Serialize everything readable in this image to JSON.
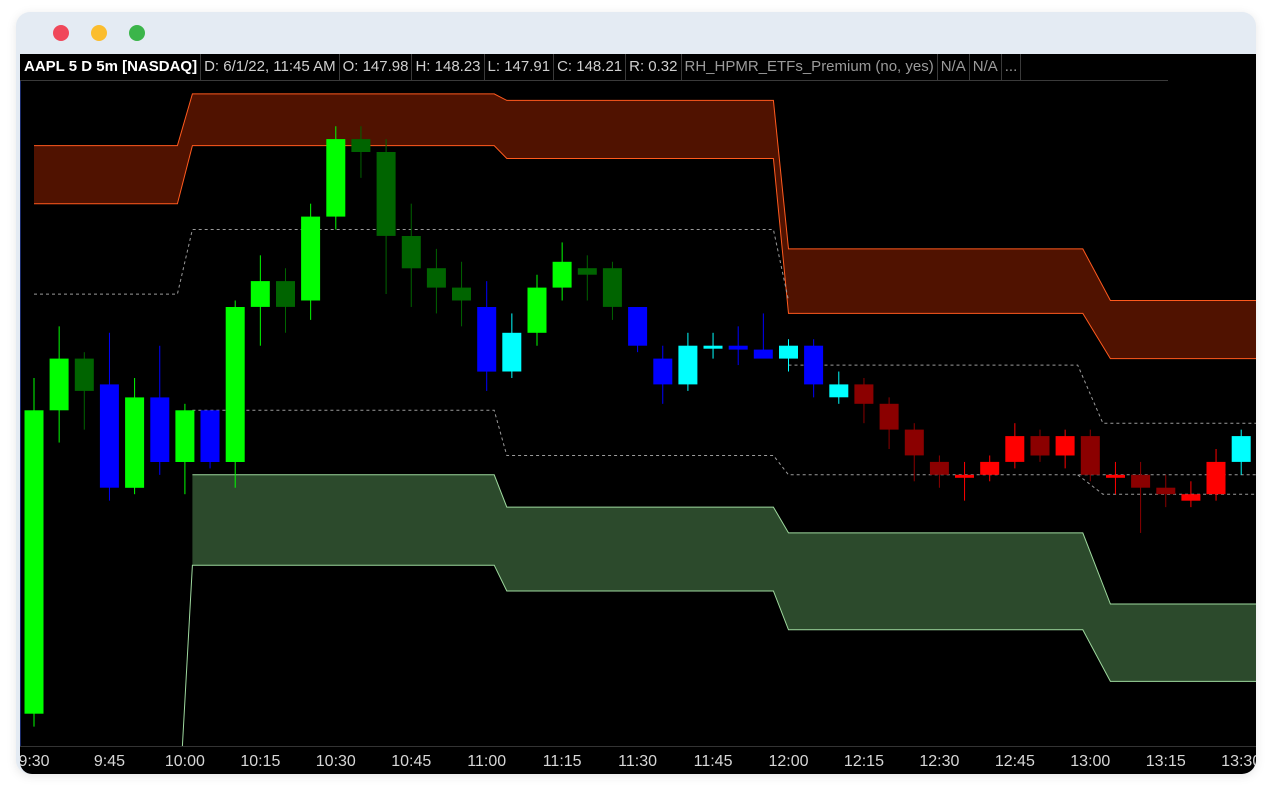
{
  "window": {
    "controls": [
      "close",
      "minimize",
      "zoom"
    ]
  },
  "header": {
    "symbol": "AAPL 5 D 5m [NASDAQ]",
    "date": "D: 6/1/22, 11:45 AM",
    "open": "O: 147.98",
    "high": "H: 148.23",
    "low": "L: 147.91",
    "close": "C: 148.21",
    "range": "R: 0.32",
    "study": "RH_HPMR_ETFs_Premium (no, yes)",
    "na1": "N/A",
    "na2": "N/A",
    "more": "..."
  },
  "colors": {
    "background": "#000000",
    "up_strong": "#00ff00",
    "up_weak": "#006400",
    "down_strong": "#ff0000",
    "down_weak": "#8b0000",
    "cyan": "#00ffff",
    "blue": "#0000ff",
    "upper_band_fill": "#501200",
    "upper_band_line": "#ff5a1e",
    "lower_band_fill": "#2c4a2c",
    "lower_band_line": "#9ed99e",
    "dashed": "#9a9a9a"
  },
  "chart_data": {
    "type": "candlestick",
    "symbol": "AAPL",
    "interval": "5m",
    "x_tick_labels": [
      "9:30",
      "9:45",
      "10:00",
      "10:15",
      "10:30",
      "10:45",
      "11:00",
      "11:15",
      "11:30",
      "11:45",
      "12:00",
      "12:15",
      "12:30",
      "12:45",
      "13:00",
      "13:15",
      "13:30"
    ],
    "candles": [
      {
        "o": 144.1,
        "h": 146.7,
        "l": 144.0,
        "c": 146.45,
        "color": "#00ff00"
      },
      {
        "o": 146.45,
        "h": 147.1,
        "l": 146.2,
        "c": 146.85,
        "color": "#00ff00"
      },
      {
        "o": 146.6,
        "h": 146.9,
        "l": 146.3,
        "c": 146.85,
        "color": "#006400"
      },
      {
        "o": 146.65,
        "h": 147.05,
        "l": 145.75,
        "c": 145.85,
        "color": "#0000ff"
      },
      {
        "o": 145.85,
        "h": 146.7,
        "l": 145.8,
        "c": 146.55,
        "color": "#00ff00"
      },
      {
        "o": 146.55,
        "h": 146.95,
        "l": 145.95,
        "c": 146.05,
        "color": "#0000ff"
      },
      {
        "o": 146.05,
        "h": 146.5,
        "l": 145.8,
        "c": 146.45,
        "color": "#00ff00"
      },
      {
        "o": 146.45,
        "h": 146.45,
        "l": 146.0,
        "c": 146.05,
        "color": "#0000ff"
      },
      {
        "o": 146.05,
        "h": 147.3,
        "l": 145.85,
        "c": 147.25,
        "color": "#00ff00"
      },
      {
        "o": 147.25,
        "h": 147.65,
        "l": 146.95,
        "c": 147.45,
        "color": "#00ff00"
      },
      {
        "o": 147.25,
        "h": 147.55,
        "l": 147.05,
        "c": 147.45,
        "color": "#006400"
      },
      {
        "o": 147.3,
        "h": 148.05,
        "l": 147.15,
        "c": 147.95,
        "color": "#00ff00"
      },
      {
        "o": 147.95,
        "h": 148.65,
        "l": 147.85,
        "c": 148.55,
        "color": "#00ff00"
      },
      {
        "o": 148.55,
        "h": 148.65,
        "l": 148.25,
        "c": 148.45,
        "color": "#006400"
      },
      {
        "o": 148.45,
        "h": 148.55,
        "l": 147.35,
        "c": 147.8,
        "color": "#006400"
      },
      {
        "o": 147.8,
        "h": 148.05,
        "l": 147.25,
        "c": 147.55,
        "color": "#006400"
      },
      {
        "o": 147.55,
        "h": 147.7,
        "l": 147.2,
        "c": 147.4,
        "color": "#006400"
      },
      {
        "o": 147.4,
        "h": 147.6,
        "l": 147.1,
        "c": 147.3,
        "color": "#006400"
      },
      {
        "o": 147.25,
        "h": 147.45,
        "l": 146.6,
        "c": 146.75,
        "color": "#0000ff"
      },
      {
        "o": 146.75,
        "h": 147.2,
        "l": 146.7,
        "c": 147.05,
        "color": "#00ffff"
      },
      {
        "o": 147.05,
        "h": 147.5,
        "l": 146.95,
        "c": 147.4,
        "color": "#00ff00"
      },
      {
        "o": 147.4,
        "h": 147.75,
        "l": 147.3,
        "c": 147.6,
        "color": "#00ff00"
      },
      {
        "o": 147.5,
        "h": 147.65,
        "l": 147.3,
        "c": 147.55,
        "color": "#006400"
      },
      {
        "o": 147.55,
        "h": 147.6,
        "l": 147.15,
        "c": 147.25,
        "color": "#006400"
      },
      {
        "o": 147.25,
        "h": 147.25,
        "l": 146.9,
        "c": 146.95,
        "color": "#0000ff"
      },
      {
        "o": 146.85,
        "h": 146.95,
        "l": 146.5,
        "c": 146.65,
        "color": "#0000ff"
      },
      {
        "o": 146.65,
        "h": 147.05,
        "l": 146.6,
        "c": 146.95,
        "color": "#00ffff"
      },
      {
        "o": 146.95,
        "h": 147.05,
        "l": 146.85,
        "c": 146.93,
        "color": "#00ffff"
      },
      {
        "o": 146.95,
        "h": 147.1,
        "l": 146.8,
        "c": 146.92,
        "color": "#0000ff"
      },
      {
        "o": 146.92,
        "h": 147.2,
        "l": 146.9,
        "c": 146.85,
        "color": "#0000ff"
      },
      {
        "o": 146.85,
        "h": 147.0,
        "l": 146.75,
        "c": 146.95,
        "color": "#00ffff"
      },
      {
        "o": 146.95,
        "h": 147.0,
        "l": 146.55,
        "c": 146.65,
        "color": "#0000ff"
      },
      {
        "o": 146.55,
        "h": 146.75,
        "l": 146.5,
        "c": 146.65,
        "color": "#00ffff"
      },
      {
        "o": 146.65,
        "h": 146.7,
        "l": 146.35,
        "c": 146.5,
        "color": "#8b0000"
      },
      {
        "o": 146.5,
        "h": 146.55,
        "l": 146.15,
        "c": 146.3,
        "color": "#8b0000"
      },
      {
        "o": 146.3,
        "h": 146.35,
        "l": 145.9,
        "c": 146.1,
        "color": "#8b0000"
      },
      {
        "o": 146.05,
        "h": 146.1,
        "l": 145.85,
        "c": 145.95,
        "color": "#8b0000"
      },
      {
        "o": 145.95,
        "h": 146.05,
        "l": 145.75,
        "c": 145.94,
        "color": "#ff0000"
      },
      {
        "o": 145.95,
        "h": 146.1,
        "l": 145.9,
        "c": 146.05,
        "color": "#ff0000"
      },
      {
        "o": 146.05,
        "h": 146.35,
        "l": 146.0,
        "c": 146.25,
        "color": "#ff0000"
      },
      {
        "o": 146.25,
        "h": 146.3,
        "l": 146.05,
        "c": 146.1,
        "color": "#8b0000"
      },
      {
        "o": 146.1,
        "h": 146.3,
        "l": 146.0,
        "c": 146.25,
        "color": "#ff0000"
      },
      {
        "o": 146.25,
        "h": 146.3,
        "l": 145.9,
        "c": 145.95,
        "color": "#8b0000"
      },
      {
        "o": 145.95,
        "h": 146.05,
        "l": 145.8,
        "c": 145.93,
        "color": "#ff0000"
      },
      {
        "o": 145.95,
        "h": 146.05,
        "l": 145.5,
        "c": 145.85,
        "color": "#8b0000"
      },
      {
        "o": 145.85,
        "h": 145.95,
        "l": 145.7,
        "c": 145.8,
        "color": "#8b0000"
      },
      {
        "o": 145.8,
        "h": 145.9,
        "l": 145.7,
        "c": 145.75,
        "color": "#ff0000"
      },
      {
        "o": 145.8,
        "h": 146.15,
        "l": 145.75,
        "c": 146.05,
        "color": "#ff0000"
      },
      {
        "o": 146.05,
        "h": 146.3,
        "l": 145.95,
        "c": 146.25,
        "color": "#00ffff"
      }
    ],
    "bands": {
      "upper_outer": [
        [
          0,
          148.5
        ],
        [
          5.7,
          148.5
        ],
        [
          6.3,
          148.9
        ],
        [
          18.3,
          148.9
        ],
        [
          18.8,
          148.85
        ],
        [
          29.4,
          148.85
        ],
        [
          30.0,
          147.7
        ],
        [
          41.7,
          147.7
        ],
        [
          42.8,
          147.3
        ],
        [
          49.0,
          147.3
        ]
      ],
      "upper_inner": [
        [
          0,
          148.05
        ],
        [
          5.7,
          148.05
        ],
        [
          6.3,
          148.5
        ],
        [
          18.3,
          148.5
        ],
        [
          18.8,
          148.4
        ],
        [
          29.4,
          148.4
        ],
        [
          30.0,
          147.2
        ],
        [
          41.7,
          147.2
        ],
        [
          42.8,
          146.85
        ],
        [
          49.0,
          146.85
        ]
      ],
      "mid_upper": [
        [
          0,
          147.35
        ],
        [
          5.7,
          147.35
        ],
        [
          6.3,
          147.85
        ],
        [
          29.4,
          147.85
        ],
        [
          30.0,
          147.3
        ]
      ],
      "mid_right": [
        [
          30.0,
          146.8
        ],
        [
          41.5,
          146.8
        ],
        [
          42.5,
          146.35
        ],
        [
          49.0,
          146.35
        ]
      ],
      "mid_lower": [
        [
          6.3,
          146.45
        ],
        [
          18.3,
          146.45
        ],
        [
          18.8,
          146.1
        ],
        [
          29.4,
          146.1
        ],
        [
          30.0,
          145.95
        ],
        [
          49.0,
          145.95
        ]
      ],
      "lower_right": [
        [
          41.5,
          145.95
        ],
        [
          42.5,
          145.8
        ],
        [
          49.0,
          145.8
        ]
      ],
      "lower_inner": [
        [
          6.3,
          145.95
        ],
        [
          18.3,
          145.95
        ],
        [
          18.8,
          145.7
        ],
        [
          29.4,
          145.7
        ],
        [
          30.0,
          145.5
        ],
        [
          41.7,
          145.5
        ],
        [
          42.8,
          144.95
        ],
        [
          49.0,
          144.95
        ]
      ],
      "lower_outer": [
        [
          5.9,
          143.85
        ],
        [
          6.3,
          145.25
        ],
        [
          18.3,
          145.25
        ],
        [
          18.8,
          145.05
        ],
        [
          29.4,
          145.05
        ],
        [
          30.0,
          144.75
        ],
        [
          41.7,
          144.75
        ],
        [
          42.8,
          144.35
        ],
        [
          49.0,
          144.35
        ]
      ]
    },
    "ylim": [
      143.85,
      149.0
    ]
  }
}
